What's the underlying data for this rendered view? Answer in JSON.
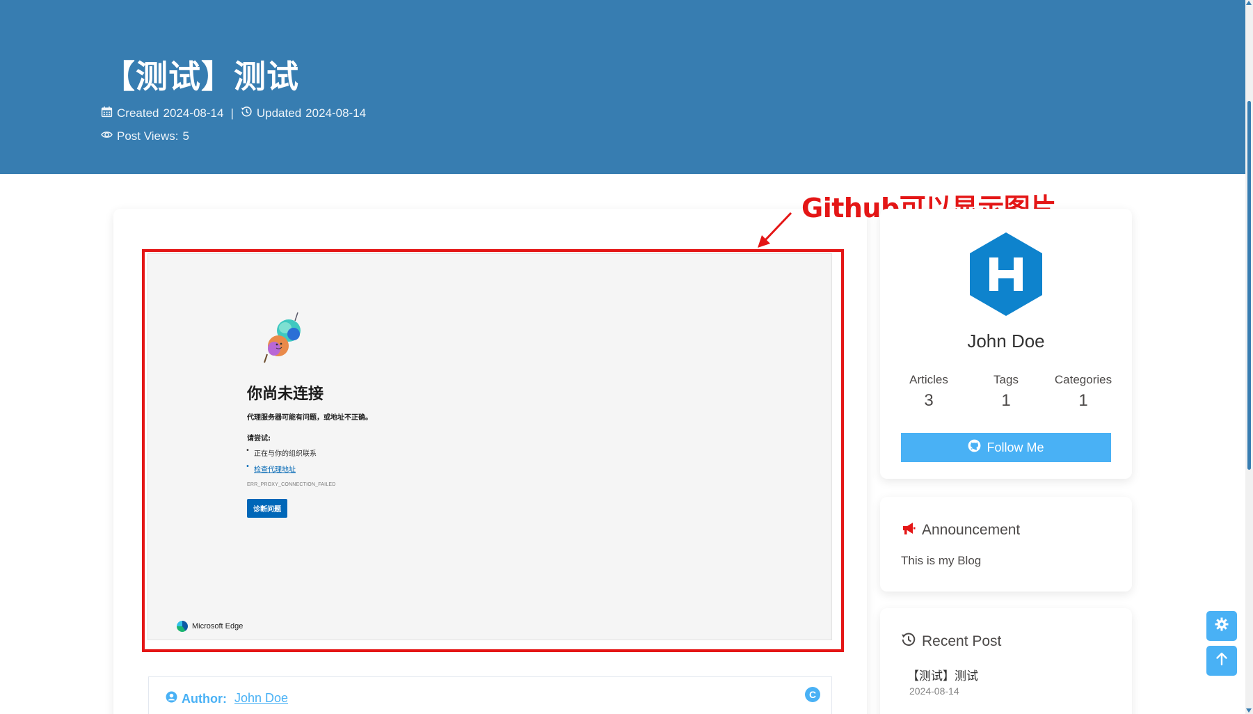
{
  "post": {
    "title": "【测试】测试",
    "created_label": "Created",
    "created_date": "2024-08-14",
    "updated_label": "Updated",
    "updated_date": "2024-08-14",
    "views_label": "Post Views:",
    "views_count": "5"
  },
  "annotation": {
    "text": "Github可以显示图片",
    "color": "#e41616"
  },
  "embedded_screenshot": {
    "title": "你尚未连接",
    "subtitle": "代理服务器可能有问题，或地址不正确。",
    "try_label": "请尝试:",
    "suggestions": [
      "正在与你的组织联系",
      "检查代理地址"
    ],
    "error_code": "ERR_PROXY_CONNECTION_FAILED",
    "button_label": "诊断问题",
    "brand": "Microsoft Edge"
  },
  "author": {
    "label": "Author:",
    "name": "John Doe"
  },
  "profile": {
    "name": "John Doe",
    "stats": [
      {
        "label": "Articles",
        "value": "3"
      },
      {
        "label": "Tags",
        "value": "1"
      },
      {
        "label": "Categories",
        "value": "1"
      }
    ],
    "follow_label": "Follow Me"
  },
  "announcement": {
    "title": "Announcement",
    "text": "This is my Blog"
  },
  "recent_post": {
    "title": "Recent Post",
    "items": [
      {
        "title": "【测试】测试",
        "date": "2024-08-14"
      }
    ]
  },
  "colors": {
    "header_bg": "#377db1",
    "accent": "#49b1f5",
    "annotation_red": "#e41616"
  },
  "icons": [
    "calendar-icon",
    "history-icon",
    "eye-icon",
    "user-circle-icon",
    "copyright-icon",
    "github-icon",
    "bullhorn-icon",
    "gear-icon",
    "arrow-up-icon"
  ]
}
